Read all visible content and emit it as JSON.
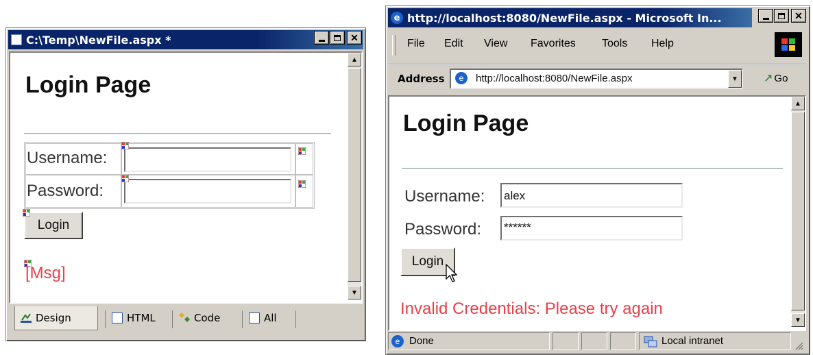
{
  "designer": {
    "title": "C:\\Temp\\NewFile.aspx *",
    "heading": "Login Page",
    "username_label": "Username:",
    "password_label": "Password:",
    "login_button": "Login",
    "msg_label": "[Msg]",
    "tabs": [
      {
        "label": "Design",
        "icon": "design-icon"
      },
      {
        "label": "HTML",
        "icon": "html-icon"
      },
      {
        "label": "Code",
        "icon": "code-icon"
      },
      {
        "label": "All",
        "icon": "all-icon"
      }
    ]
  },
  "browser": {
    "title": "http://localhost:8080/NewFile.aspx - Microsoft In...",
    "menu": [
      "File",
      "Edit",
      "View",
      "Favorites",
      "Tools",
      "Help"
    ],
    "address_label": "Address",
    "address_value": "http://localhost:8080/NewFile.aspx",
    "go_label": "Go",
    "heading": "Login Page",
    "username_label": "Username:",
    "username_value": "alex",
    "password_label": "Password:",
    "password_value": "******",
    "login_button": "Login",
    "error_message": "Invalid Credentials: Please try again",
    "status_text": "Done",
    "zone_text": "Local intranet"
  },
  "colors": {
    "designer_title_bg": "#0a246a",
    "browser_title_bg": "#0a246a",
    "error_red": "#e8404a",
    "msg_red": "#e8404a"
  }
}
